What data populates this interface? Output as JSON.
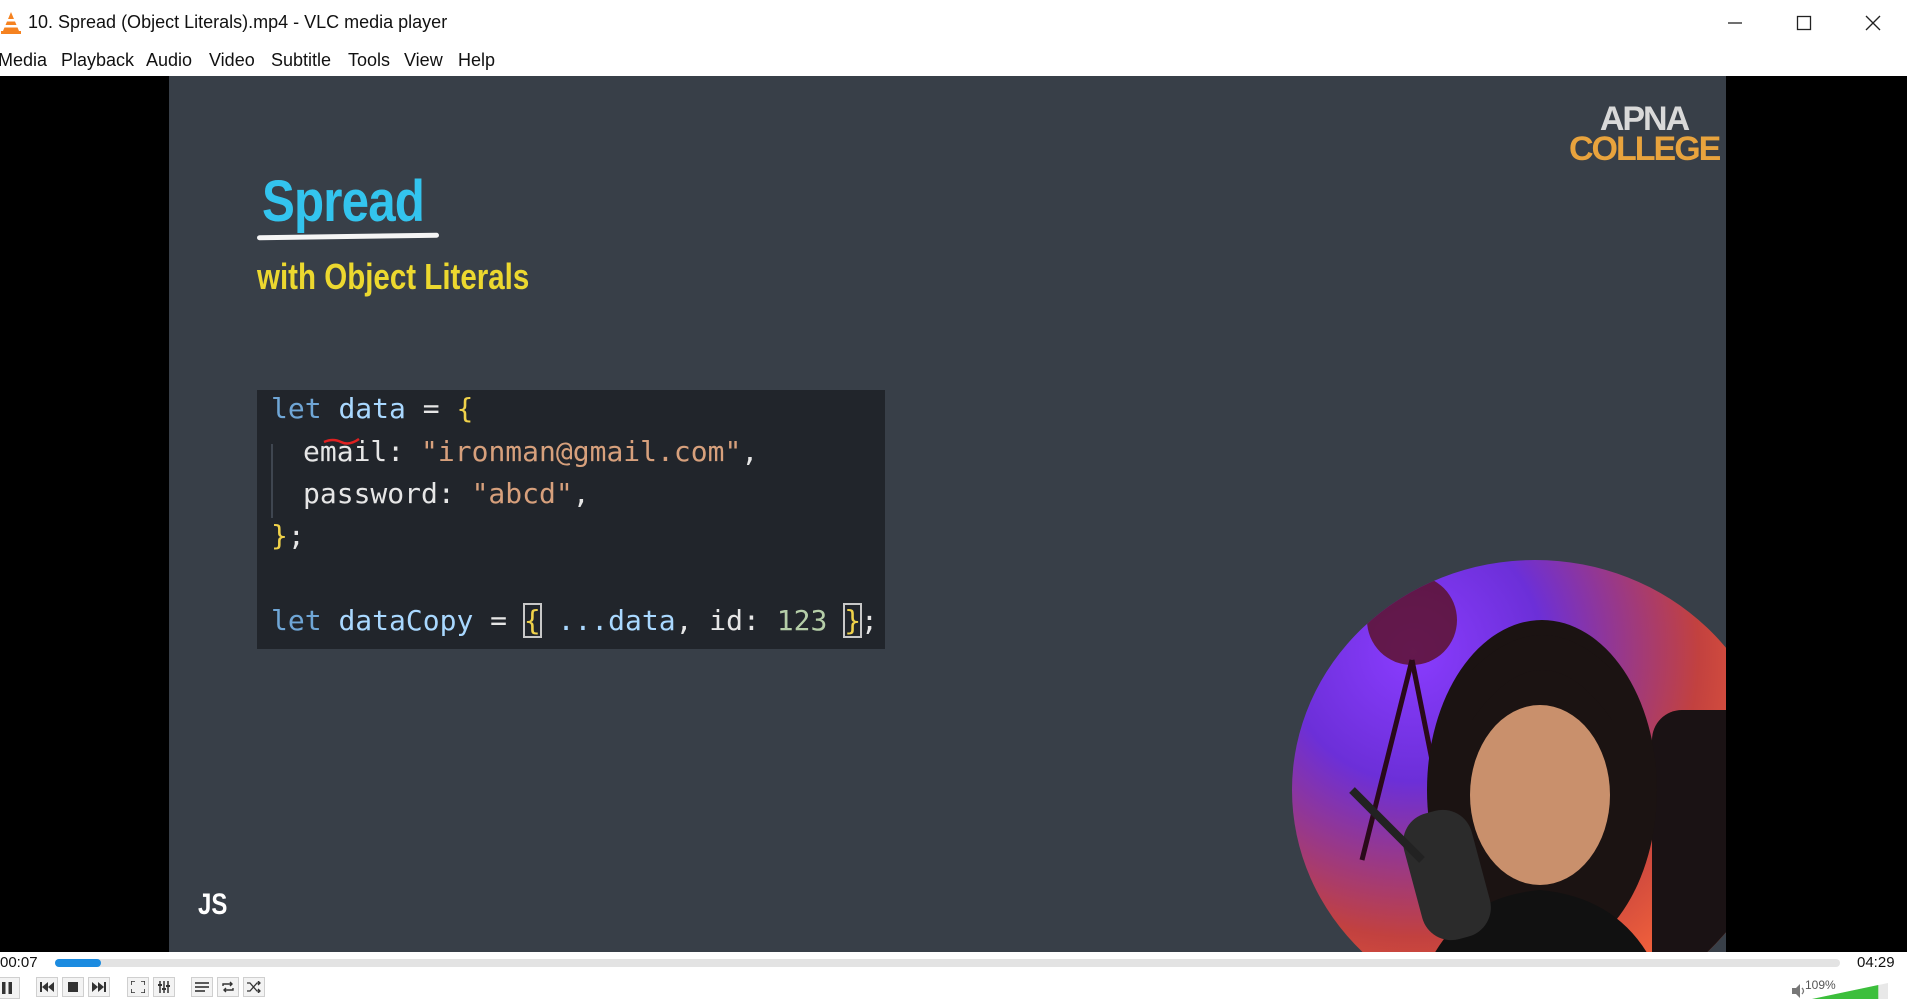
{
  "window": {
    "title": "10. Spread (Object Literals).mp4 - VLC media player"
  },
  "menu": {
    "items": [
      "Media",
      "Playback",
      "Audio",
      "Video",
      "Subtitle",
      "Tools",
      "View",
      "Help"
    ]
  },
  "slide": {
    "logo_top": "APNA",
    "logo_bottom": "COLLEGE",
    "heading": "Spread",
    "subheading": "with Object Literals",
    "tag": "JS",
    "code": {
      "l1_let": "let",
      "l1_var": "data",
      "l1_eq": " = ",
      "l1_brace": "{",
      "l2_key": "email: ",
      "l2_val": "\"ironman@gmail.com\"",
      "l2_comma": ",",
      "l3_key": "password: ",
      "l3_val": "\"abcd\"",
      "l3_comma": ",",
      "l4_brace": "}",
      "l4_semi": ";",
      "l6_let": "let",
      "l6_var": "dataCopy",
      "l6_eq": " = ",
      "l6_open": "{",
      "l6_spread": " ...data",
      "l6_mid": ", id: ",
      "l6_num": "123",
      "l6_close": "}",
      "l6_semi": ";"
    }
  },
  "player": {
    "time_current": "00:07",
    "time_total": "04:29",
    "progress": 0.026,
    "volume_label": "109%",
    "volume": 1.09
  },
  "colors": {
    "slide_bg": "#383f48",
    "heading": "#33c4ee",
    "subheading": "#ecd82f",
    "seek": "#1b8be0"
  }
}
